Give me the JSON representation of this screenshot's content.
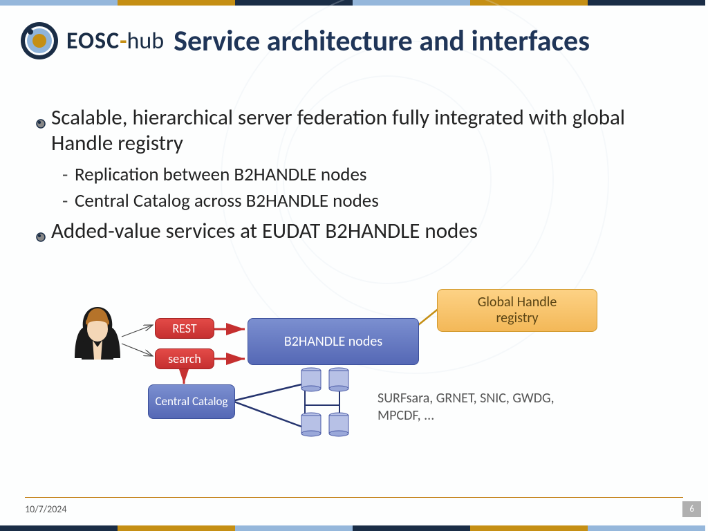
{
  "logo": {
    "eosc": "EOSC",
    "dash": "-",
    "hub": "hub"
  },
  "title": "Service architecture and interfaces",
  "bullets": {
    "b1": "Scalable, hierarchical server federation fully integrated with global Handle registry",
    "b1_subs": [
      "Replication between B2HANDLE nodes",
      "Central Catalog across B2HANDLE nodes"
    ],
    "b2": "Added-value services at EUDAT B2HANDLE nodes"
  },
  "diagram": {
    "rest": "REST",
    "search": "search",
    "b2handle": "B2HANDLE nodes",
    "catalog": "Central Catalog",
    "global": "Global Handle registry",
    "sites": "SURFsara, GRNET, SNIC, GWDG, MPCDF, ..."
  },
  "footer": {
    "date": "10/7/2024",
    "page": "6"
  }
}
